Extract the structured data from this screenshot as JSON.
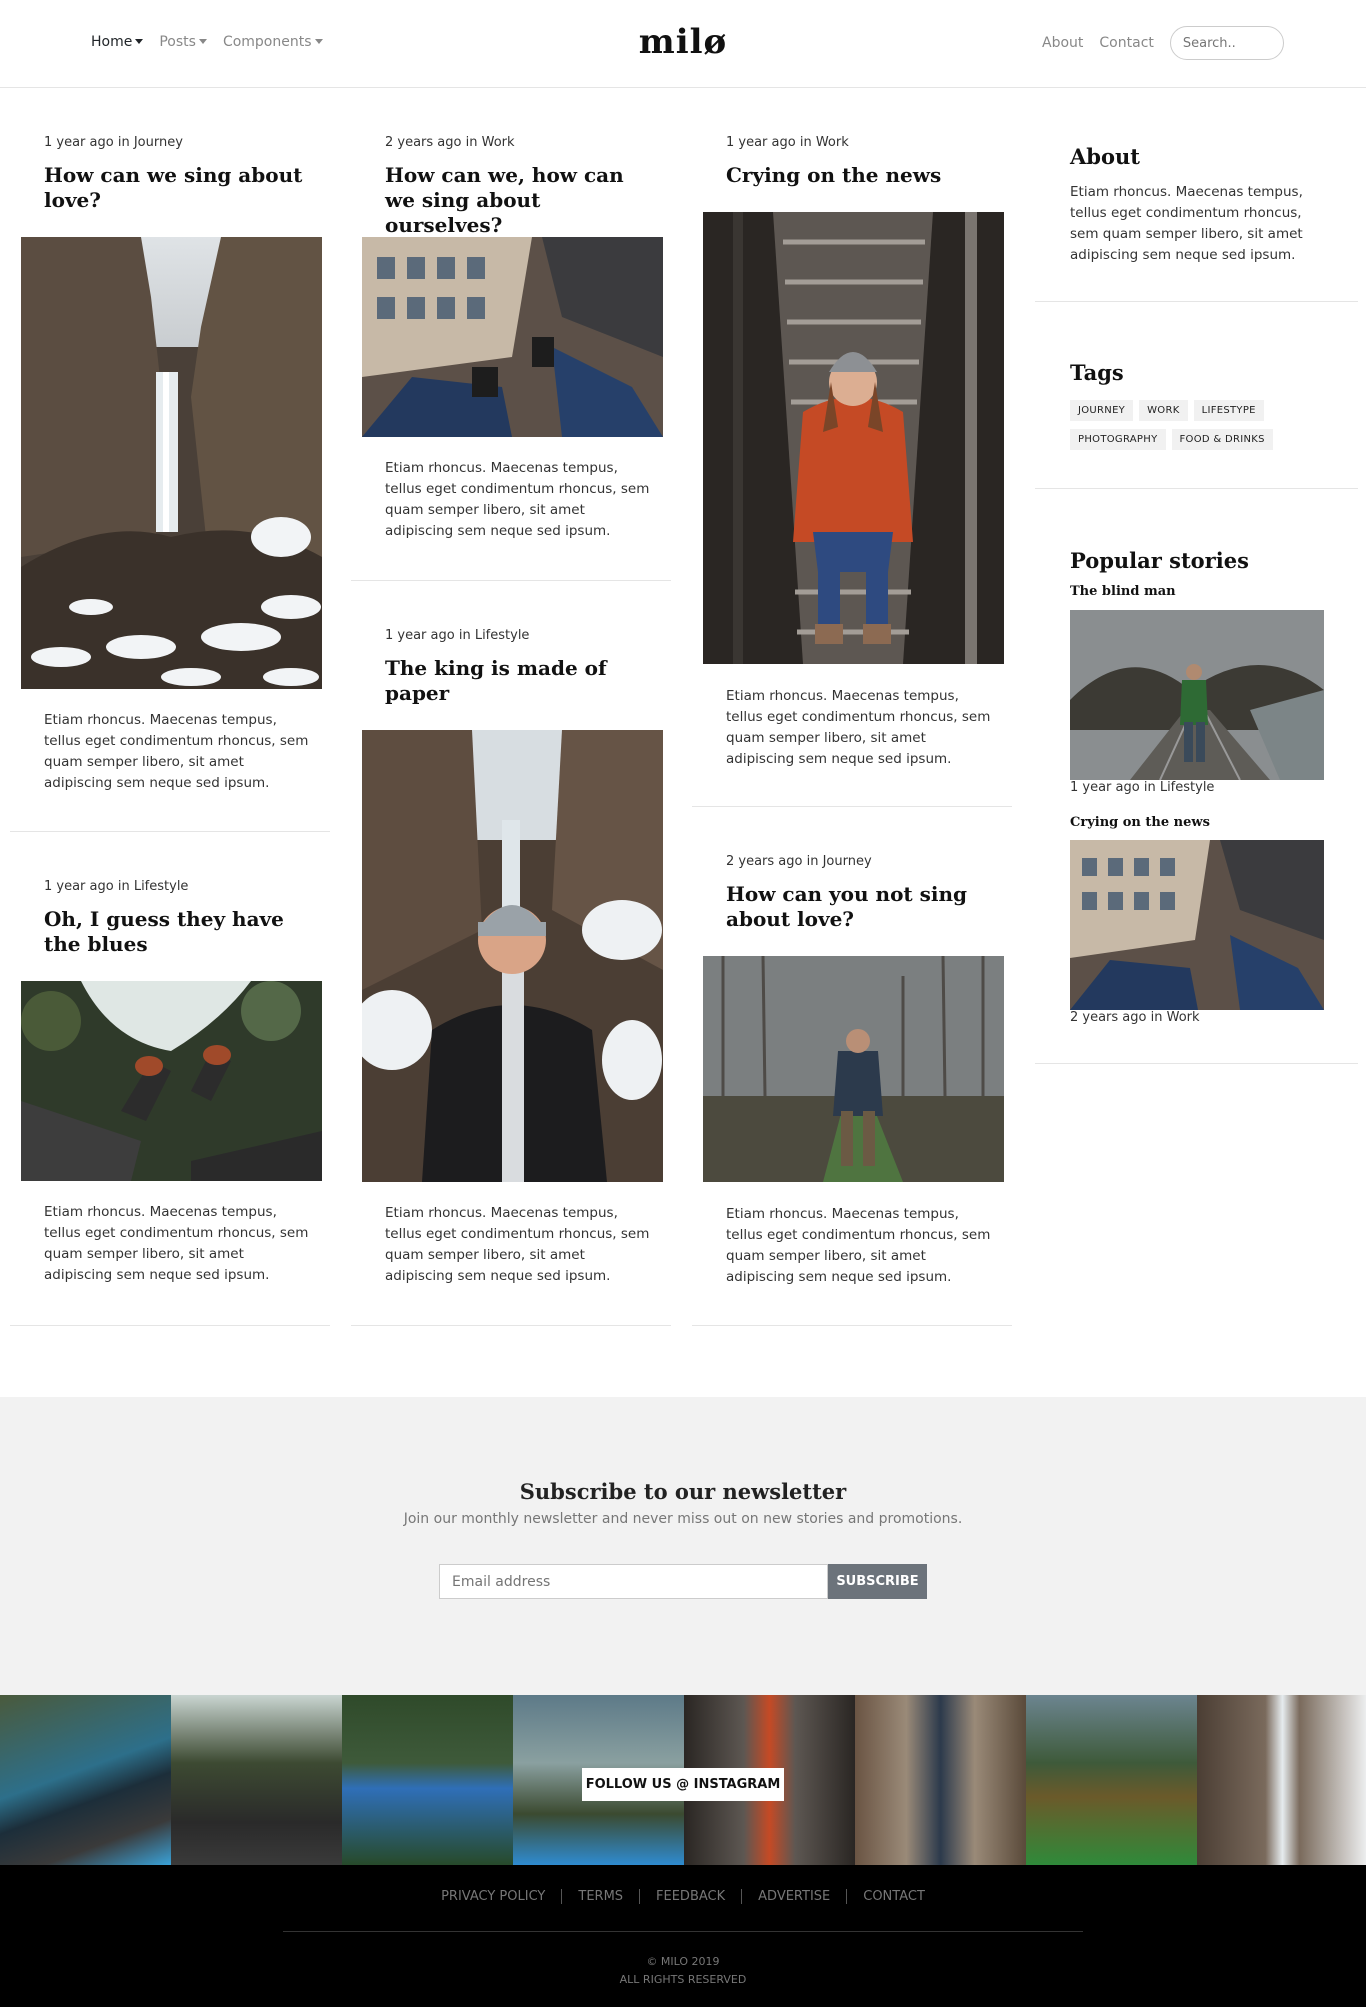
{
  "nav": {
    "brand": "milø",
    "left_items": [
      {
        "label": "Home"
      },
      {
        "label": "Posts"
      },
      {
        "label": "Components"
      }
    ],
    "right_items": [
      {
        "label": "About"
      },
      {
        "label": "Contact"
      }
    ],
    "search_placeholder": "Search.."
  },
  "posts": [
    {
      "meta": "1 year ago in Journey",
      "title": "How can we sing about love?",
      "excerpt": "Etiam rhoncus. Maecenas tempus, tellus eget condimentum rhoncus, sem quam semper libero, sit amet adipiscing sem neque sed ipsum."
    },
    {
      "meta": "1 year ago in Lifestyle",
      "title": "Oh, I guess they have the blues",
      "excerpt": "Etiam rhoncus. Maecenas tempus, tellus eget condimentum rhoncus, sem quam semper libero, sit amet adipiscing sem neque sed ipsum."
    },
    {
      "meta": "2 years ago in Work",
      "title": "How can we, how can we sing about ourselves?",
      "excerpt": "Etiam rhoncus. Maecenas tempus, tellus eget condimentum rhoncus, sem quam semper libero, sit amet adipiscing sem neque sed ipsum."
    },
    {
      "meta": "1 year ago in Lifestyle",
      "title": "The king is made of paper",
      "excerpt": "Etiam rhoncus. Maecenas tempus, tellus eget condimentum rhoncus, sem quam semper libero, sit amet adipiscing sem neque sed ipsum."
    },
    {
      "meta": "1 year ago in Work",
      "title": "Crying on the news",
      "excerpt": "Etiam rhoncus. Maecenas tempus, tellus eget condimentum rhoncus, sem quam semper libero, sit amet adipiscing sem neque sed ipsum."
    },
    {
      "meta": "2 years ago in Journey",
      "title": "How can you not sing about love?",
      "excerpt": "Etiam rhoncus. Maecenas tempus, tellus eget condimentum rhoncus, sem quam semper libero, sit amet adipiscing sem neque sed ipsum."
    }
  ],
  "sidebar": {
    "about_title": "About",
    "about_text": "Etiam rhoncus. Maecenas tempus, tellus eget condimentum rhoncus, sem quam semper libero, sit amet adipiscing sem neque sed ipsum.",
    "tags_title": "Tags",
    "tags": [
      "JOURNEY",
      "WORK",
      "LIFESTYPE",
      "PHOTOGRAPHY",
      "FOOD & DRINKS"
    ],
    "popular_title": "Popular stories",
    "popular": [
      {
        "title": "The blind man",
        "meta": "1 year ago in Lifestyle"
      },
      {
        "title": "Crying on the news",
        "meta": "2 years ago in Work"
      }
    ]
  },
  "newsletter": {
    "title": "Subscribe to our newsletter",
    "subtitle": "Join our monthly newsletter and never miss out on new stories and promotions.",
    "email_placeholder": "Email address",
    "button": "SUBSCRIBE"
  },
  "instagram": {
    "button": "FOLLOW US @ INSTAGRAM"
  },
  "footer": {
    "links": [
      "PRIVACY POLICY",
      "TERMS",
      "FEEDBACK",
      "ADVERTISE",
      "CONTACT"
    ],
    "copyright": "© MILO 2019",
    "rights": "ALL RIGHTS RESERVED"
  }
}
